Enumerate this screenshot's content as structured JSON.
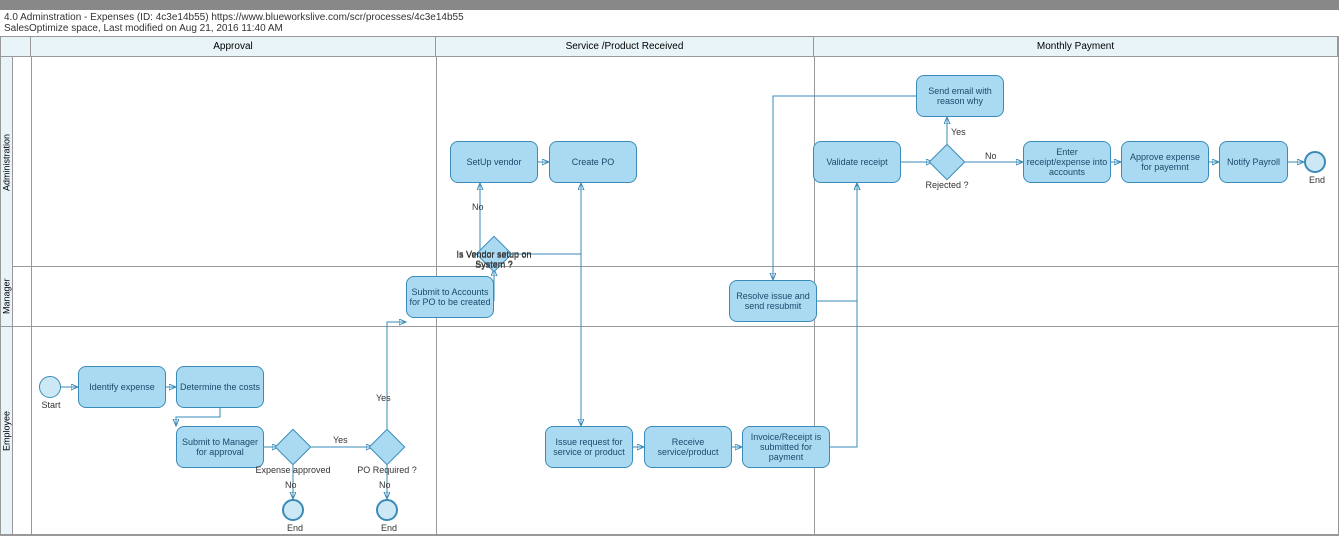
{
  "header": {
    "title_line1": "4.0 Adminstration - Expenses (ID: 4c3e14b55) https://www.blueworkslive.com/scr/processes/4c3e14b55",
    "title_line2": "SalesOptimize space, Last modified on Aug 21, 2016 11:40 AM"
  },
  "phases": {
    "p1": "Approval",
    "p2": "Service /Product Received",
    "p3": "Monthly Payment"
  },
  "lanes": {
    "admin": "Administration",
    "manager": "Manager",
    "employee": "Employee"
  },
  "tasks": {
    "identify": "Identify expense",
    "determine": "Determine the costs",
    "submit_mgr": "Submit to Manager for approval",
    "submit_acc": "Submit to Accounts for PO to be created",
    "setup_vendor": "SetUp vendor",
    "create_po": "Create PO",
    "issue_req": "Issue request for service or product",
    "receive": "Receive service/product",
    "invoice": "Invoice/Receipt is submitted for payment",
    "resolve": "Resolve issue and send resubmit",
    "validate": "Validate receipt",
    "send_email": "Send email with reason why",
    "enter_receipt": "Enter receipt/expense into accounts",
    "approve_exp": "Approve expense for payemnt",
    "notify": "Notify Payroll"
  },
  "gateways": {
    "expense_approved": "Expense approved",
    "po_required": "PO Required ?",
    "vendor_setup": "Is Vendor setup on System ?",
    "rejected": "Rejected ?"
  },
  "events": {
    "start": "Start",
    "end": "End"
  },
  "labels": {
    "yes": "Yes",
    "no": "No"
  }
}
